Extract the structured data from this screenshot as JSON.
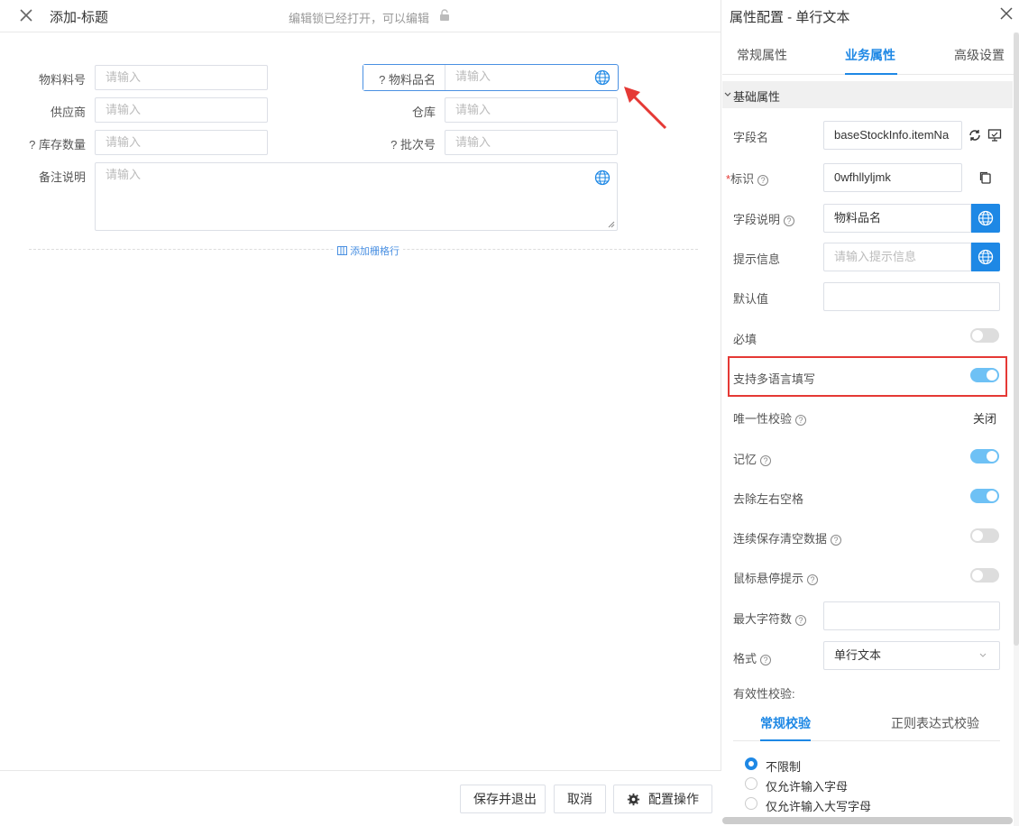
{
  "header": {
    "title": "添加-标题",
    "lock_message": "编辑锁已经打开，可以编辑"
  },
  "form": {
    "placeholder": "请输入",
    "fields": {
      "material_no": "物料料号",
      "material_name": "? 物料品名",
      "supplier": "供应商",
      "warehouse": "仓库",
      "stock_qty": "? 库存数量",
      "batch_no": "? 批次号",
      "remark": "备注说明"
    },
    "add_row_label": "添加栅格行"
  },
  "footer": {
    "save_exit": "保存并退出",
    "cancel": "取消",
    "config": "配置操作"
  },
  "panel": {
    "title": "属性配置 - 单行文本",
    "tabs": [
      "常规属性",
      "业务属性",
      "高级设置"
    ],
    "active_tab": "业务属性",
    "section": "基础属性",
    "field_name_label": "字段名",
    "field_name_value": "baseStockInfo.itemNa",
    "identifier_label": "标识",
    "identifier_value": "0wfhllyljmk",
    "field_desc_label": "字段说明",
    "field_desc_value": "物料品名",
    "hint_label": "提示信息",
    "hint_placeholder": "请输入提示信息",
    "default_label": "默认值",
    "required_label": "必填",
    "required": false,
    "multilang_label": "支持多语言填写",
    "multilang": true,
    "unique_label": "唯一性校验",
    "unique_value": "关闭",
    "memory_label": "记忆",
    "memory": true,
    "trim_label": "去除左右空格",
    "trim": true,
    "clear_label": "连续保存清空数据",
    "clear": false,
    "hover_label": "鼠标悬停提示",
    "hover": false,
    "maxlen_label": "最大字符数",
    "format_label": "格式",
    "format_value": "单行文本",
    "validity_label": "有效性校验:",
    "subtabs": [
      "常规校验",
      "正则表达式校验"
    ],
    "radios": [
      "不限制",
      "仅允许输入字母",
      "仅允许输入大写字母"
    ],
    "radio_selected": "不限制"
  },
  "colors": {
    "accent": "#1e88e5",
    "toggle_on": "#6ec1f5",
    "highlight": "#e53935"
  }
}
